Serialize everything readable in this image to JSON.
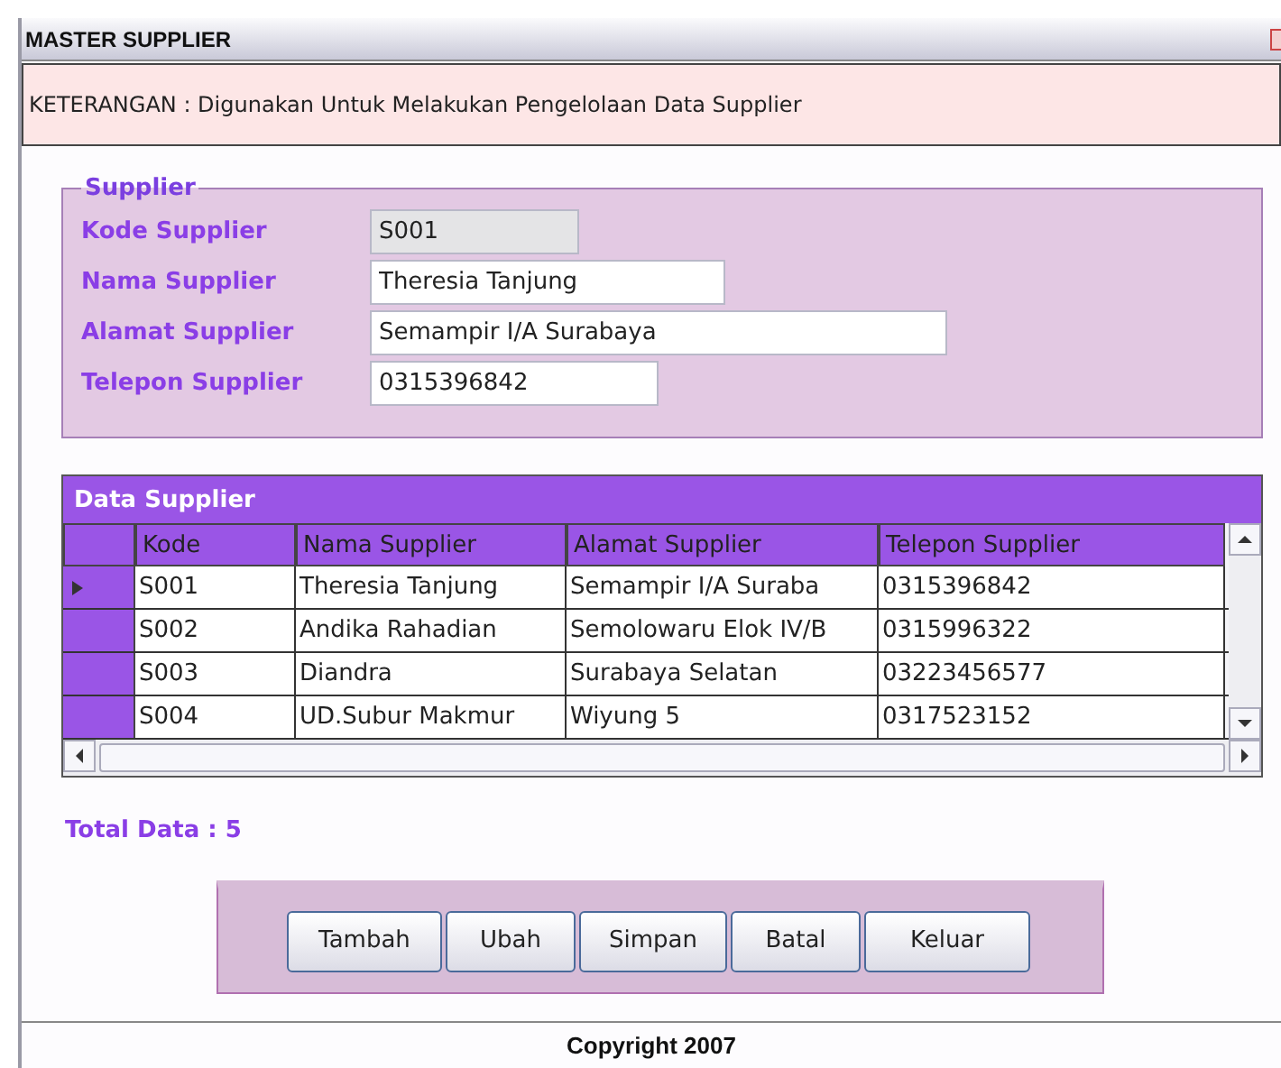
{
  "window": {
    "title": "MASTER SUPPLIER"
  },
  "description": "KETERANGAN : Digunakan Untuk Melakukan Pengelolaan Data Supplier",
  "supplier_group": {
    "title": "Supplier",
    "fields": [
      {
        "label": "Kode Supplier",
        "value": "S001",
        "disabled": true
      },
      {
        "label": "Nama Supplier",
        "value": "Theresia Tanjung",
        "disabled": false
      },
      {
        "label": "Alamat Supplier",
        "value": "Semampir I/A Surabaya",
        "disabled": false
      },
      {
        "label": "Telepon Supplier",
        "value": "0315396842",
        "disabled": false
      }
    ]
  },
  "table": {
    "title": "Data Supplier",
    "columns": [
      "Kode",
      "Nama Supplier",
      "Alamat Supplier",
      "Telepon Supplier"
    ],
    "rows": [
      {
        "cells": [
          "S001",
          "Theresia Tanjung",
          "Semampir I/A Suraba",
          "0315396842"
        ],
        "selected": true
      },
      {
        "cells": [
          "S002",
          "Andika Rahadian",
          "Semolowaru Elok IV/B",
          "0315996322"
        ],
        "selected": false
      },
      {
        "cells": [
          "S003",
          "Diandra",
          "Surabaya Selatan",
          "03223456577"
        ],
        "selected": false
      },
      {
        "cells": [
          "S004",
          "UD.Subur Makmur",
          "Wiyung 5",
          "0317523152"
        ],
        "selected": false
      }
    ]
  },
  "total": "Total Data : 5",
  "buttons": [
    "Tambah",
    "Ubah",
    "Simpan",
    "Batal",
    "Keluar"
  ],
  "footer": "Copyright 2007"
}
